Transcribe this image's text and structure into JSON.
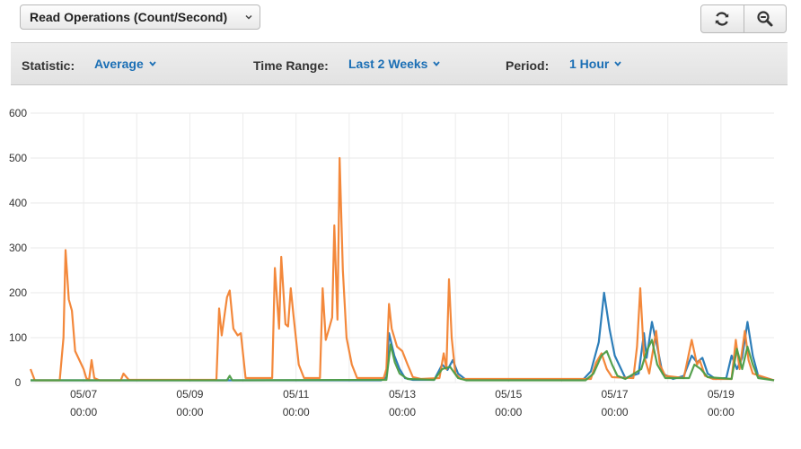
{
  "metric_selector": {
    "label": "Read Operations (Count/Second)",
    "icon": "chevron-down-icon"
  },
  "actions": {
    "refresh_icon": "refresh-icon",
    "zoom_icon": "zoom-out-icon"
  },
  "toolbar": {
    "statistic": {
      "label": "Statistic:",
      "value": "Average"
    },
    "time_range": {
      "label": "Time Range:",
      "value": "Last 2 Weeks"
    },
    "period": {
      "label": "Period:",
      "value": "1 Hour"
    },
    "accent_color": "#1b6fb5"
  },
  "chart_data": {
    "type": "line",
    "ylim": [
      0,
      600
    ],
    "xlim": [
      0,
      14
    ],
    "y_ticks": [
      0,
      100,
      200,
      300,
      400,
      500,
      600
    ],
    "x_ticks": [
      {
        "x": 1.0,
        "date": "05/07",
        "time": "00:00"
      },
      {
        "x": 3.0,
        "date": "05/09",
        "time": "00:00"
      },
      {
        "x": 5.0,
        "date": "05/11",
        "time": "00:00"
      },
      {
        "x": 7.0,
        "date": "05/13",
        "time": "00:00"
      },
      {
        "x": 9.0,
        "date": "05/15",
        "time": "00:00"
      },
      {
        "x": 11.0,
        "date": "05/17",
        "time": "00:00"
      },
      {
        "x": 13.0,
        "date": "05/19",
        "time": "00:00"
      }
    ],
    "grid": true,
    "series": [
      {
        "color": "#2277b5",
        "points": [
          [
            0,
            5
          ],
          [
            6.6,
            5
          ],
          [
            6.7,
            12
          ],
          [
            6.75,
            110
          ],
          [
            6.85,
            60
          ],
          [
            6.95,
            30
          ],
          [
            7.05,
            10
          ],
          [
            7.2,
            6
          ],
          [
            7.6,
            6
          ],
          [
            7.75,
            40
          ],
          [
            7.85,
            28
          ],
          [
            7.95,
            50
          ],
          [
            8.05,
            20
          ],
          [
            8.2,
            6
          ],
          [
            10.4,
            6
          ],
          [
            10.55,
            25
          ],
          [
            10.7,
            90
          ],
          [
            10.8,
            200
          ],
          [
            10.9,
            120
          ],
          [
            11.0,
            60
          ],
          [
            11.2,
            10
          ],
          [
            11.45,
            20
          ],
          [
            11.55,
            110
          ],
          [
            11.6,
            55
          ],
          [
            11.7,
            135
          ],
          [
            11.8,
            80
          ],
          [
            11.9,
            20
          ],
          [
            12.1,
            8
          ],
          [
            12.3,
            15
          ],
          [
            12.45,
            60
          ],
          [
            12.55,
            45
          ],
          [
            12.65,
            55
          ],
          [
            12.75,
            20
          ],
          [
            12.9,
            8
          ],
          [
            13.1,
            10
          ],
          [
            13.2,
            60
          ],
          [
            13.3,
            30
          ],
          [
            13.4,
            55
          ],
          [
            13.5,
            135
          ],
          [
            13.6,
            60
          ],
          [
            13.7,
            15
          ],
          [
            14,
            5
          ]
        ]
      },
      {
        "color": "#f28230",
        "points": [
          [
            0,
            30
          ],
          [
            0.08,
            5
          ],
          [
            0.55,
            5
          ],
          [
            0.62,
            100
          ],
          [
            0.66,
            295
          ],
          [
            0.72,
            185
          ],
          [
            0.78,
            160
          ],
          [
            0.84,
            70
          ],
          [
            0.92,
            50
          ],
          [
            1.0,
            30
          ],
          [
            1.05,
            10
          ],
          [
            1.1,
            5
          ],
          [
            1.15,
            50
          ],
          [
            1.2,
            10
          ],
          [
            1.3,
            5
          ],
          [
            1.7,
            5
          ],
          [
            1.75,
            20
          ],
          [
            1.85,
            6
          ],
          [
            3.5,
            6
          ],
          [
            3.55,
            165
          ],
          [
            3.6,
            105
          ],
          [
            3.7,
            190
          ],
          [
            3.75,
            205
          ],
          [
            3.82,
            120
          ],
          [
            3.9,
            105
          ],
          [
            3.96,
            110
          ],
          [
            4.05,
            10
          ],
          [
            4.55,
            10
          ],
          [
            4.6,
            255
          ],
          [
            4.68,
            120
          ],
          [
            4.72,
            280
          ],
          [
            4.8,
            130
          ],
          [
            4.85,
            125
          ],
          [
            4.9,
            210
          ],
          [
            4.95,
            150
          ],
          [
            5.05,
            40
          ],
          [
            5.15,
            10
          ],
          [
            5.45,
            10
          ],
          [
            5.5,
            210
          ],
          [
            5.56,
            95
          ],
          [
            5.62,
            120
          ],
          [
            5.68,
            145
          ],
          [
            5.72,
            350
          ],
          [
            5.78,
            140
          ],
          [
            5.82,
            500
          ],
          [
            5.88,
            250
          ],
          [
            5.95,
            100
          ],
          [
            6.05,
            40
          ],
          [
            6.15,
            10
          ],
          [
            6.65,
            10
          ],
          [
            6.7,
            30
          ],
          [
            6.75,
            175
          ],
          [
            6.8,
            120
          ],
          [
            6.9,
            80
          ],
          [
            7.0,
            70
          ],
          [
            7.1,
            40
          ],
          [
            7.2,
            12
          ],
          [
            7.35,
            8
          ],
          [
            7.7,
            10
          ],
          [
            7.78,
            65
          ],
          [
            7.83,
            30
          ],
          [
            7.88,
            230
          ],
          [
            7.93,
            100
          ],
          [
            8.0,
            20
          ],
          [
            8.1,
            8
          ],
          [
            10.55,
            8
          ],
          [
            10.65,
            45
          ],
          [
            10.75,
            65
          ],
          [
            10.85,
            30
          ],
          [
            10.95,
            12
          ],
          [
            11.35,
            10
          ],
          [
            11.42,
            80
          ],
          [
            11.48,
            210
          ],
          [
            11.55,
            60
          ],
          [
            11.65,
            20
          ],
          [
            11.78,
            115
          ],
          [
            11.85,
            40
          ],
          [
            11.95,
            15
          ],
          [
            12.3,
            10
          ],
          [
            12.45,
            95
          ],
          [
            12.55,
            40
          ],
          [
            12.6,
            50
          ],
          [
            12.7,
            15
          ],
          [
            12.85,
            8
          ],
          [
            13.2,
            8
          ],
          [
            13.28,
            95
          ],
          [
            13.35,
            30
          ],
          [
            13.45,
            115
          ],
          [
            13.52,
            50
          ],
          [
            13.6,
            20
          ],
          [
            14,
            5
          ]
        ]
      },
      {
        "color": "#4c9c45",
        "points": [
          [
            0,
            5
          ],
          [
            3.7,
            5
          ],
          [
            3.75,
            15
          ],
          [
            3.8,
            5
          ],
          [
            6.7,
            6
          ],
          [
            6.78,
            85
          ],
          [
            6.86,
            45
          ],
          [
            6.95,
            20
          ],
          [
            7.1,
            8
          ],
          [
            7.6,
            6
          ],
          [
            7.75,
            30
          ],
          [
            7.9,
            35
          ],
          [
            8.05,
            10
          ],
          [
            8.2,
            5
          ],
          [
            10.45,
            5
          ],
          [
            10.6,
            20
          ],
          [
            10.75,
            60
          ],
          [
            10.85,
            70
          ],
          [
            10.95,
            40
          ],
          [
            11.05,
            15
          ],
          [
            11.2,
            8
          ],
          [
            11.5,
            30
          ],
          [
            11.6,
            70
          ],
          [
            11.7,
            95
          ],
          [
            11.8,
            40
          ],
          [
            11.95,
            10
          ],
          [
            12.4,
            10
          ],
          [
            12.5,
            40
          ],
          [
            12.62,
            30
          ],
          [
            12.75,
            12
          ],
          [
            13.2,
            8
          ],
          [
            13.3,
            75
          ],
          [
            13.4,
            30
          ],
          [
            13.5,
            80
          ],
          [
            13.6,
            40
          ],
          [
            13.7,
            10
          ],
          [
            14,
            5
          ]
        ]
      }
    ]
  }
}
